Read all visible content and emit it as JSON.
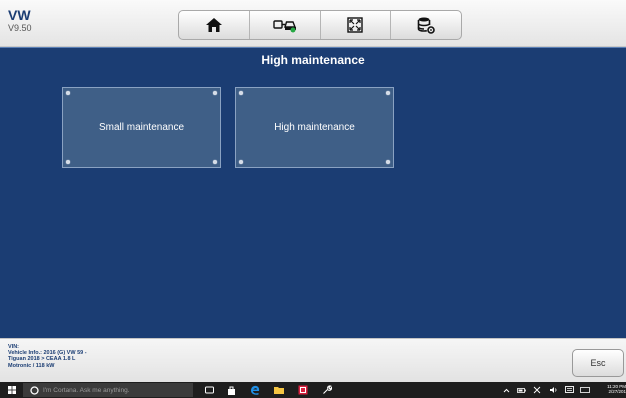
{
  "header": {
    "app_name": "VW",
    "version": "V9.50"
  },
  "toolbar": {
    "buttons": [
      {
        "icon": "home-icon"
      },
      {
        "icon": "vehicle-swap-icon"
      },
      {
        "icon": "fullscreen-icon"
      },
      {
        "icon": "database-settings-icon"
      }
    ]
  },
  "page": {
    "title": "High maintenance"
  },
  "tiles": [
    {
      "label": "Small maintenance"
    },
    {
      "label": "High maintenance"
    }
  ],
  "footer": {
    "vin_label": "VIN:",
    "vehicle_info_1": "Vehicle Info.: 2016 (G) VW 59 -",
    "vehicle_info_2": "Tiguan 2018 > CEAA 1.8 L",
    "vehicle_info_3": "Motronic / 118 kW",
    "esc_label": "Esc"
  },
  "taskbar": {
    "search_placeholder": "I'm Cortana. Ask me anything.",
    "time": "11:20 PM",
    "date": "2/27/201"
  },
  "colors": {
    "primary": "#1b3d73",
    "tile": "#3f5f87",
    "taskbar": "#1e1e1e"
  }
}
